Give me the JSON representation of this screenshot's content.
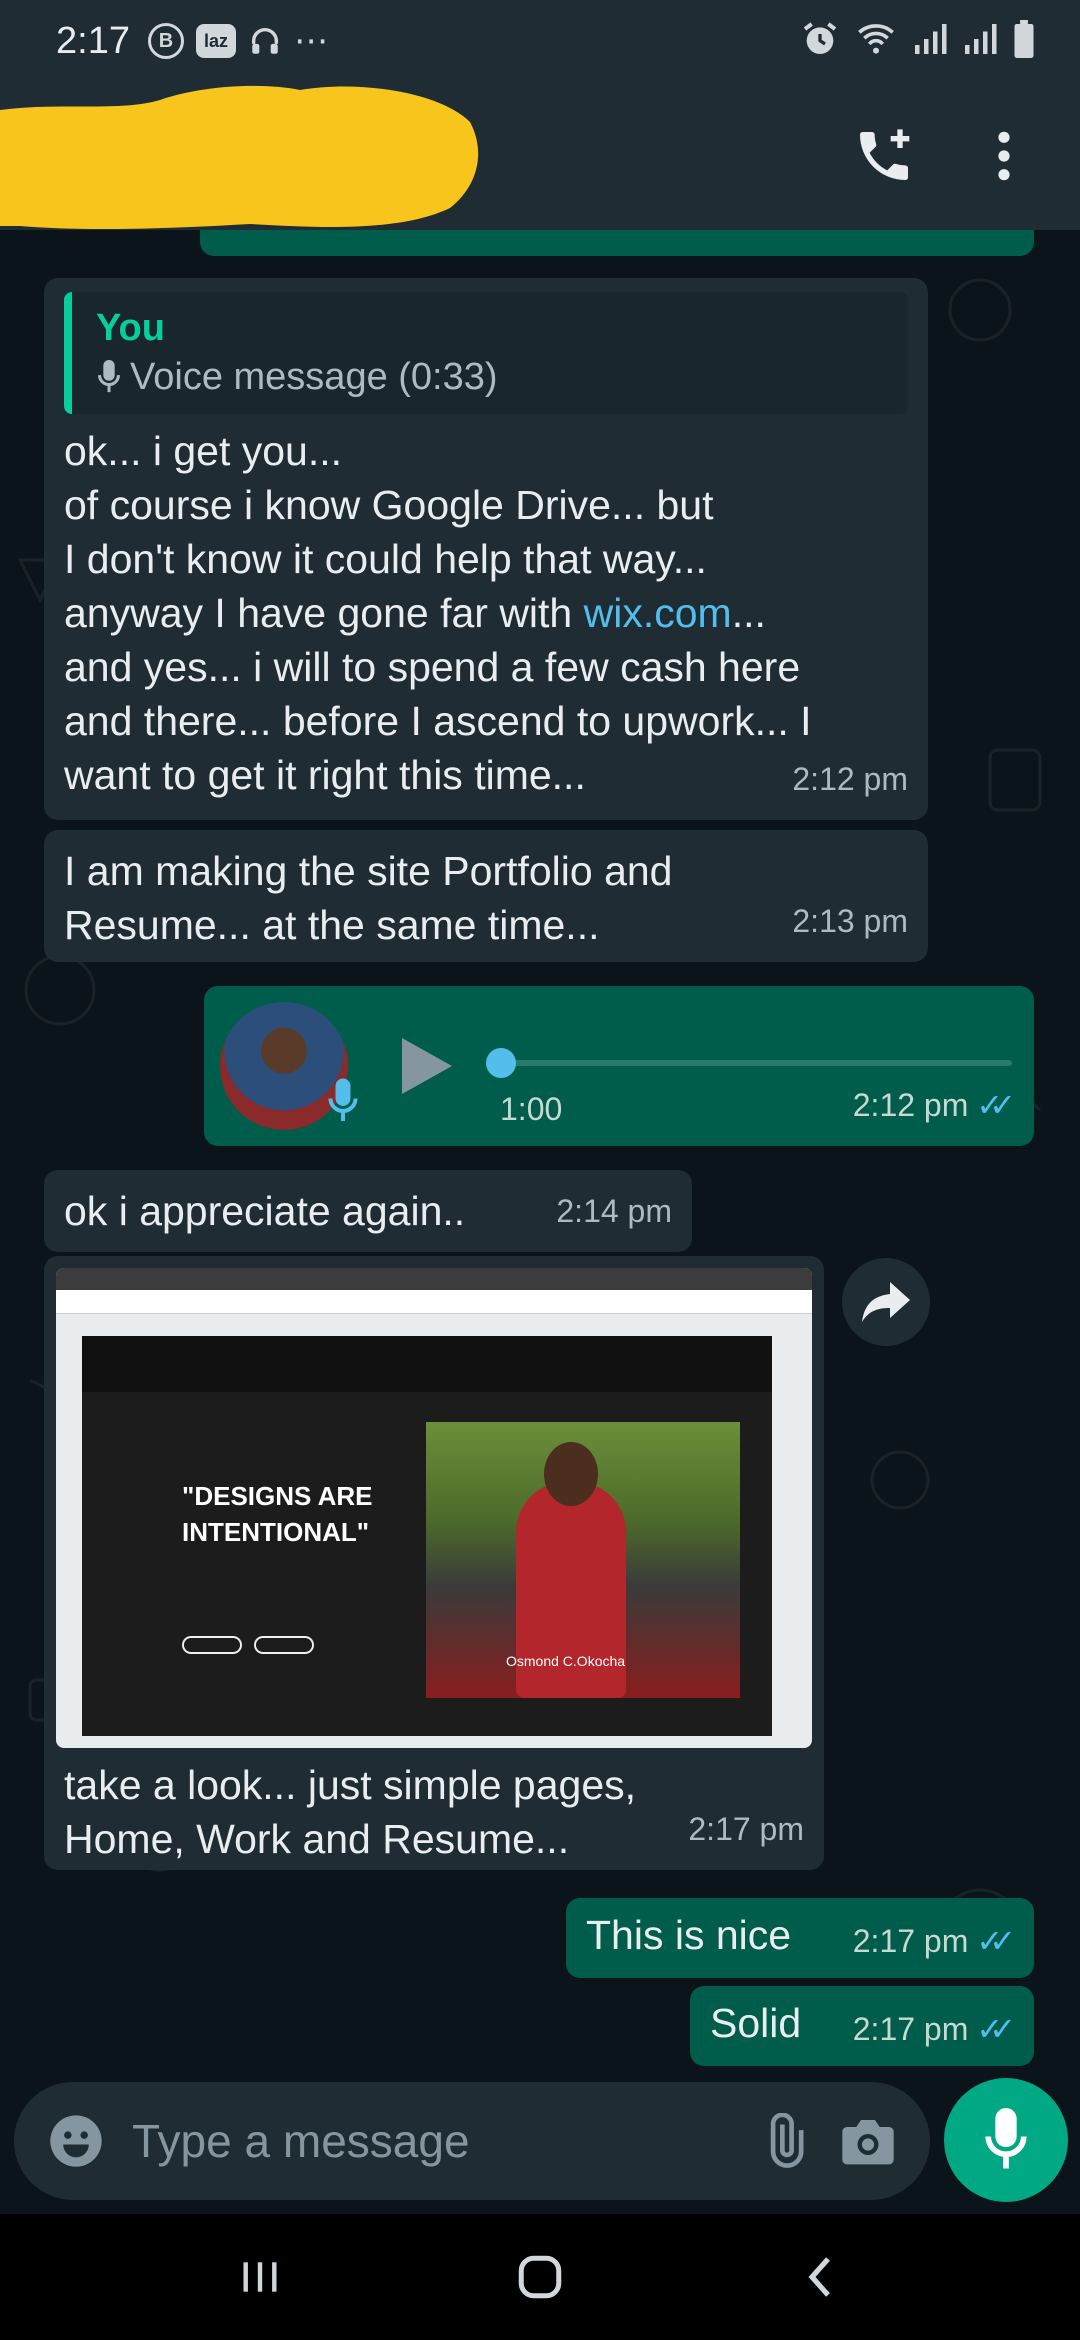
{
  "status_bar": {
    "time": "2:17",
    "badges": [
      "B",
      "laz"
    ],
    "more": "⋯"
  },
  "header": {
    "contact_name_redacted": true,
    "icons": [
      "add-call-icon",
      "more-vert-icon"
    ]
  },
  "colors": {
    "accent": "#00a884",
    "incoming_bubble": "#1f2c34",
    "outgoing_bubble": "#005c4b",
    "read_ticks": "#53bdeb",
    "quote_author": "#06cf9c"
  },
  "messages": [
    {
      "id": "m1",
      "direction": "incoming",
      "quote": {
        "author": "You",
        "text": "Voice message (0:33)"
      },
      "lines": [
        "ok... i get you...",
        "of course i know Google Drive... but",
        "I don't know it could help that way...",
        "anyway I have gone far with ",
        "and yes... i will to spend a few cash here",
        "and there... before I ascend to upwork... I",
        "want to get it right this time..."
      ],
      "link": "wix.com",
      "link_suffix": "...",
      "time": "2:12 pm"
    },
    {
      "id": "m2",
      "direction": "incoming",
      "lines": [
        "I am making the site Portfolio and",
        "Resume... at the same time..."
      ],
      "time": "2:13 pm"
    },
    {
      "id": "m3",
      "direction": "outgoing",
      "type": "voice",
      "duration": "1:00",
      "time": "2:12 pm",
      "read": true
    },
    {
      "id": "m4",
      "direction": "incoming",
      "text": "ok i appreciate again..",
      "time": "2:14 pm"
    },
    {
      "id": "m5",
      "direction": "incoming",
      "type": "image",
      "image_text": {
        "headline": "\"DESIGNS ARE INTENTIONAL\"",
        "caption_name": "Osmond C.Okocha"
      },
      "lines": [
        "take a look... just simple pages,",
        "Home, Work and Resume..."
      ],
      "time": "2:17 pm"
    },
    {
      "id": "m6",
      "direction": "outgoing",
      "text": "This is nice",
      "time": "2:17 pm",
      "read": true
    },
    {
      "id": "m7",
      "direction": "outgoing",
      "text": "Solid",
      "time": "2:17 pm",
      "read": true
    }
  ],
  "composer": {
    "placeholder": "Type a message"
  },
  "ticks_glyph": "✓✓"
}
